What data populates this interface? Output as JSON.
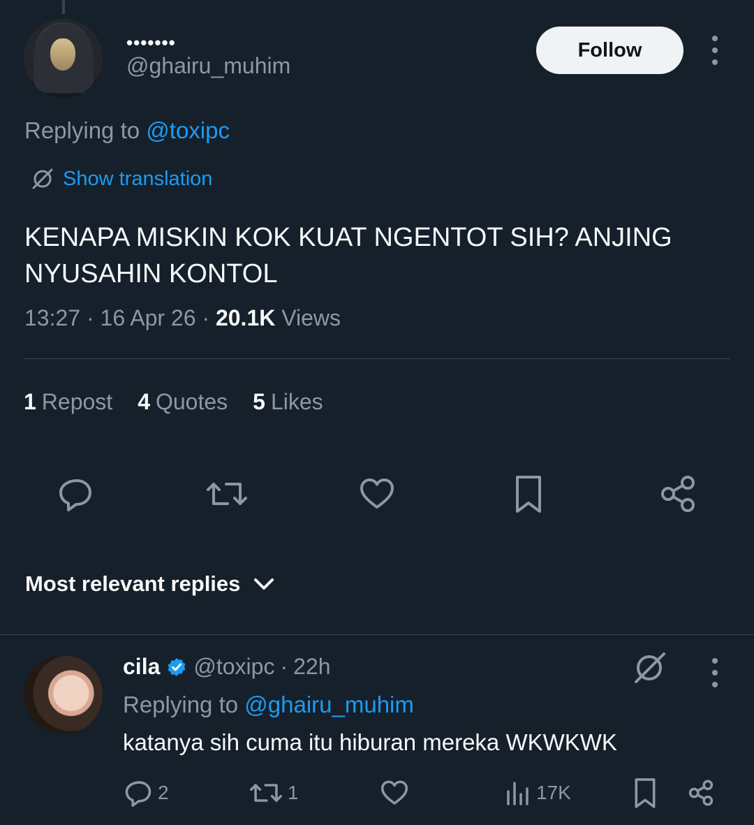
{
  "tweet": {
    "display_name": "•••••••",
    "handle": "@ghairu_muhim",
    "follow_label": "Follow",
    "replying_prefix": "Replying to",
    "replying_handle": "@toxipc",
    "translation_label": "Show translation",
    "text": "KENAPA MISKIN KOK KUAT NGENTOT SIH? ANJING NYUSAHIN KONTOL",
    "time": "13:27",
    "date": "16 Apr 26",
    "views_count": "20.1K",
    "views_label": "Views"
  },
  "stats": [
    {
      "count": "1",
      "label": "Repost"
    },
    {
      "count": "4",
      "label": "Quotes"
    },
    {
      "count": "5",
      "label": "Likes"
    }
  ],
  "actions": [
    "reply-icon",
    "repost-icon",
    "like-icon",
    "bookmark-icon",
    "share-icon"
  ],
  "sort_label": "Most relevant replies",
  "reply": {
    "name": "cila",
    "handle": "@toxipc",
    "age": "22h",
    "replying_prefix": "Replying to",
    "replying_handle": "@ghairu_muhim",
    "text": "katanya sih cuma itu hiburan mereka WKWKWK",
    "reply_count": "2",
    "repost_count": "1",
    "views_count": "17K"
  },
  "colors": {
    "background": "#15202b",
    "accent": "#1d9bf0",
    "secondary_text": "#8b98a5",
    "primary_text": "#f7f9f9",
    "divider": "#38444d"
  }
}
